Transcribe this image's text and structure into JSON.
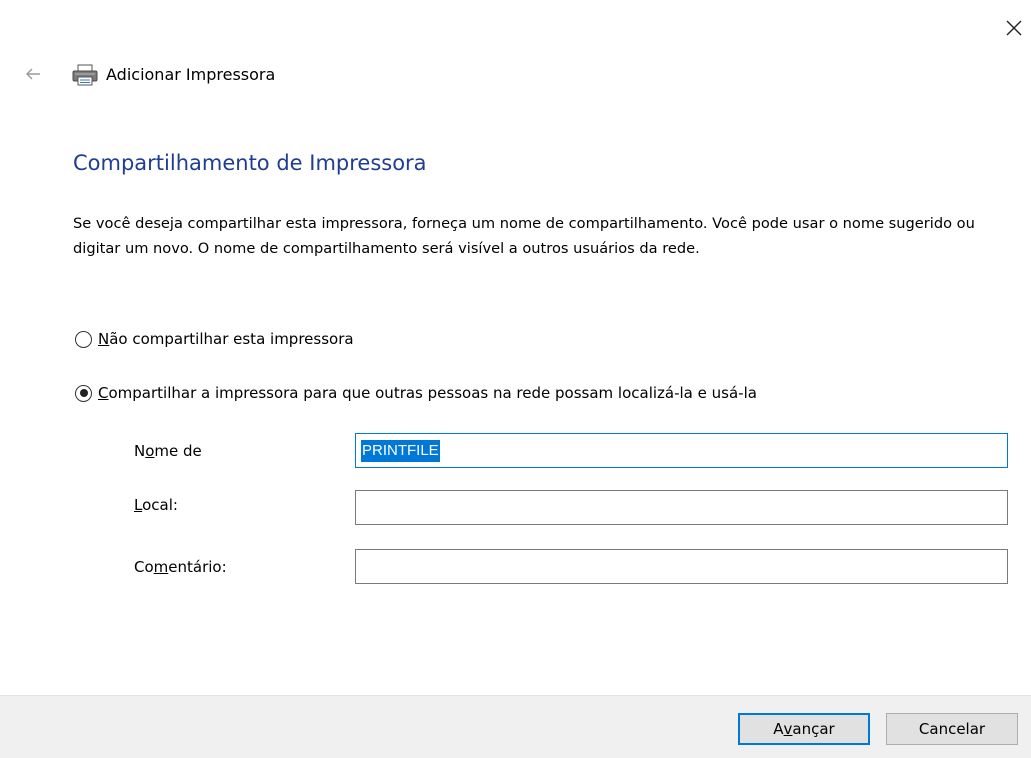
{
  "window": {
    "title": "Adicionar Impressora",
    "close_icon": "close-icon",
    "back_icon": "back-arrow-icon",
    "printer_icon": "printer-icon"
  },
  "page": {
    "heading": "Compartilhamento de Impressora",
    "description": "Se você deseja compartilhar esta impressora, forneça um nome de compartilhamento. Você pode usar o nome sugerido ou digitar um novo. O nome de compartilhamento será visível a outros usuários da rede."
  },
  "options": {
    "no_share": {
      "label_u": "N",
      "label_rest": "ão compartilhar esta impressora",
      "selected": false
    },
    "share": {
      "label_u": "C",
      "label_rest": "ompartilhar a impressora para que outras pessoas na rede possam localizá-la e usá-la",
      "selected": true
    }
  },
  "fields": {
    "share_name": {
      "label_pre": "N",
      "label_u": "o",
      "label_post": "me de",
      "value": "PRINTFILE"
    },
    "location": {
      "label_u": "L",
      "label_post": "ocal:",
      "value": ""
    },
    "comment": {
      "label_pre": "Co",
      "label_u": "m",
      "label_post": "entário:",
      "value": ""
    }
  },
  "buttons": {
    "next": {
      "pre": "A",
      "u": "v",
      "post": "ançar"
    },
    "cancel": {
      "label": "Cancelar"
    }
  },
  "colors": {
    "accent": "#0078d7",
    "heading": "#1f3d93",
    "footer_bg": "#f0f0f0"
  }
}
